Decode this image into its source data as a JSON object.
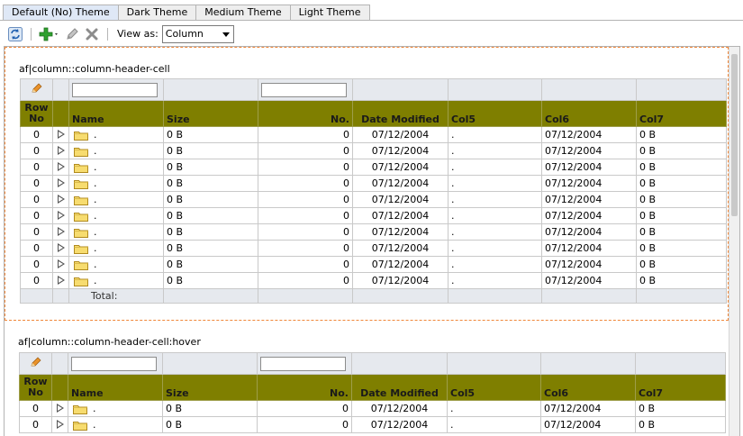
{
  "tabs": [
    {
      "label": "Default (No) Theme",
      "active": true
    },
    {
      "label": "Dark Theme",
      "active": false
    },
    {
      "label": "Medium Theme",
      "active": false
    },
    {
      "label": "Light Theme",
      "active": false
    }
  ],
  "toolbar": {
    "refresh_icon": "refresh-icon",
    "add_icon": "add-icon",
    "edit_icon": "edit-icon",
    "delete_icon": "delete-icon",
    "view_as_label": "View as:",
    "view_as_value": "Column"
  },
  "colors": {
    "header_bg": "#7f7f00",
    "focus_border": "#f0873a",
    "filter_bg": "#e6e9ee"
  },
  "sections": [
    {
      "title": "af|column::column-header-cell",
      "headers": [
        "Row No",
        "Name",
        "Size",
        "No.",
        "Date Modified",
        "Col5",
        "Col6",
        "Col7"
      ],
      "rows": [
        {
          "rowno": "0",
          "name": ".",
          "size": "0 B",
          "no": "0",
          "date": "07/12/2004",
          "col5": ".",
          "col6": "07/12/2004",
          "col7": "0 B"
        },
        {
          "rowno": "0",
          "name": ".",
          "size": "0 B",
          "no": "0",
          "date": "07/12/2004",
          "col5": ".",
          "col6": "07/12/2004",
          "col7": "0 B"
        },
        {
          "rowno": "0",
          "name": ".",
          "size": "0 B",
          "no": "0",
          "date": "07/12/2004",
          "col5": ".",
          "col6": "07/12/2004",
          "col7": "0 B"
        },
        {
          "rowno": "0",
          "name": ".",
          "size": "0 B",
          "no": "0",
          "date": "07/12/2004",
          "col5": ".",
          "col6": "07/12/2004",
          "col7": "0 B"
        },
        {
          "rowno": "0",
          "name": ".",
          "size": "0 B",
          "no": "0",
          "date": "07/12/2004",
          "col5": ".",
          "col6": "07/12/2004",
          "col7": "0 B"
        },
        {
          "rowno": "0",
          "name": ".",
          "size": "0 B",
          "no": "0",
          "date": "07/12/2004",
          "col5": ".",
          "col6": "07/12/2004",
          "col7": "0 B"
        },
        {
          "rowno": "0",
          "name": ".",
          "size": "0 B",
          "no": "0",
          "date": "07/12/2004",
          "col5": ".",
          "col6": "07/12/2004",
          "col7": "0 B"
        },
        {
          "rowno": "0",
          "name": ".",
          "size": "0 B",
          "no": "0",
          "date": "07/12/2004",
          "col5": ".",
          "col6": "07/12/2004",
          "col7": "0 B"
        },
        {
          "rowno": "0",
          "name": ".",
          "size": "0 B",
          "no": "0",
          "date": "07/12/2004",
          "col5": ".",
          "col6": "07/12/2004",
          "col7": "0 B"
        },
        {
          "rowno": "0",
          "name": ".",
          "size": "0 B",
          "no": "0",
          "date": "07/12/2004",
          "col5": ".",
          "col6": "07/12/2004",
          "col7": "0 B"
        }
      ],
      "total_label": "Total:"
    },
    {
      "title": "af|column::column-header-cell:hover",
      "headers": [
        "Row No",
        "Name",
        "Size",
        "No.",
        "Date Modified",
        "Col5",
        "Col6",
        "Col7"
      ],
      "rows": [
        {
          "rowno": "0",
          "name": ".",
          "size": "0 B",
          "no": "0",
          "date": "07/12/2004",
          "col5": ".",
          "col6": "07/12/2004",
          "col7": "0 B"
        },
        {
          "rowno": "0",
          "name": ".",
          "size": "0 B",
          "no": "0",
          "date": "07/12/2004",
          "col5": ".",
          "col6": "07/12/2004",
          "col7": "0 B"
        }
      ]
    }
  ]
}
